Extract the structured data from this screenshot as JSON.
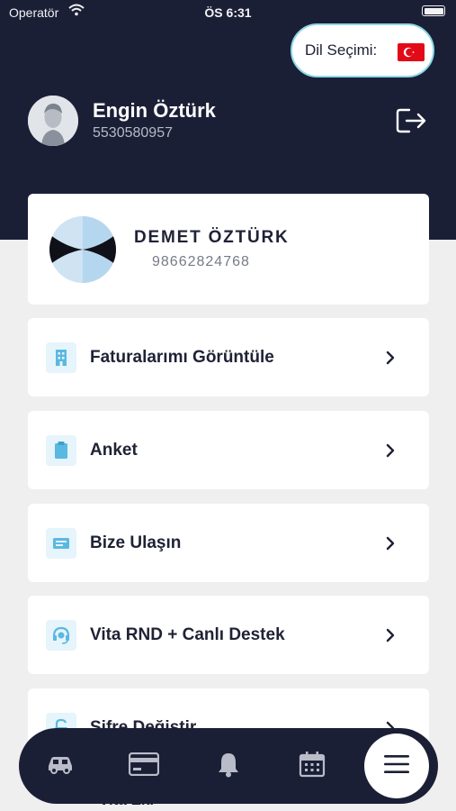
{
  "status_bar": {
    "carrier": "Operatör",
    "time": "ÖS 6:31"
  },
  "language": {
    "label": "Dil Seçimi:",
    "flag": "turkey-flag-icon"
  },
  "profile": {
    "name": "Engin Öztürk",
    "phone": "5530580957"
  },
  "member": {
    "name": "DEMET ÖZTÜRK",
    "id": "98662824768"
  },
  "menu": [
    {
      "label": "Faturalarımı Görüntüle",
      "icon": "building-icon"
    },
    {
      "label": "Anket",
      "icon": "clipboard-icon"
    },
    {
      "label": "Bize Ulaşın",
      "icon": "contact-card-icon"
    },
    {
      "label": "Vita RND + Canlı Destek",
      "icon": "headset-icon"
    },
    {
      "label": "Şifre Değiştir",
      "icon": "unlock-icon"
    },
    {
      "label": "Vita Ekr",
      "icon": ""
    }
  ],
  "tabbar": [
    {
      "icon": "car-icon"
    },
    {
      "icon": "credit-card-icon"
    },
    {
      "icon": "bell-icon"
    },
    {
      "icon": "calendar-icon"
    },
    {
      "icon": "menu-icon"
    }
  ],
  "colors": {
    "header_bg": "#1b1f36",
    "accent": "#8ed8e8",
    "icon_blue": "#5ab9e0",
    "page_bg": "#efeff0",
    "flag_red": "#e30a17"
  }
}
